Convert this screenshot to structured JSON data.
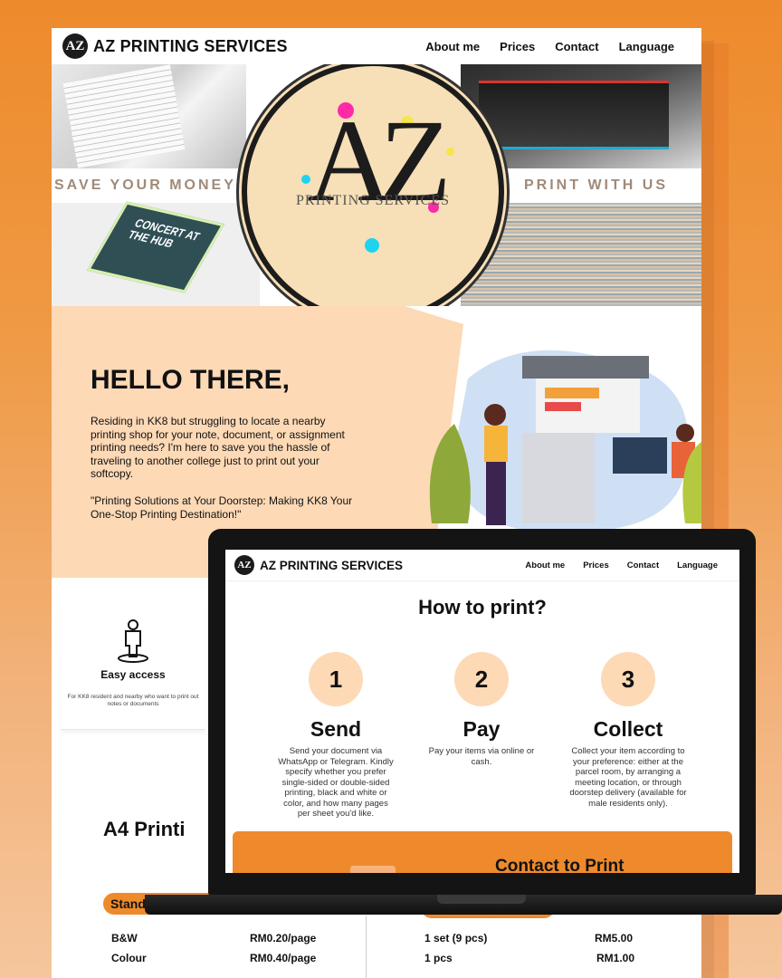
{
  "brand": {
    "logo": "AZ",
    "name": "AZ PRINTING SERVICES"
  },
  "nav": [
    "About me",
    "Prices",
    "Contact",
    "Language"
  ],
  "hero": {
    "left_text": "SAVE YOUR MONEY",
    "right_text": "PRINT WITH US",
    "circle_logo": "AZ",
    "circle_sub": "PRINTING SERVICES",
    "flyer_text": "CONCERT AT THE HUB"
  },
  "hello": {
    "title": "HELLO THERE,",
    "p1": "Residing in KK8 but struggling to locate a nearby printing shop for your note, document, or assignment printing needs? I'm here to save you the hassle of traveling to another college just to print out your softcopy.",
    "p2": "\"Printing Solutions at Your Doorstep: Making KK8 Your One-Stop Printing Destination!\""
  },
  "feature": {
    "title": "Easy access",
    "desc": "For KK8 resident and nearby who want to print out notes or documents"
  },
  "pricing": {
    "title": "A4 Printi",
    "pill_left": "Stand",
    "rows_left": [
      {
        "label": "B&W",
        "price": "RM0.20/page"
      },
      {
        "label": "Colour",
        "price": "RM0.40/page"
      }
    ],
    "rows_right": [
      {
        "label": "1 set (9 pcs)",
        "price": "RM5.00"
      },
      {
        "label": "1 pcs",
        "price": "RM1.00"
      }
    ]
  },
  "laptop": {
    "brand": "AZ PRINTING SERVICES",
    "logo": "AZ",
    "nav": [
      "About me",
      "Prices",
      "Contact",
      "Language"
    ],
    "heading": "How to print?",
    "steps": [
      {
        "num": "1",
        "title": "Send",
        "desc": "Send your document via WhatsApp or Telegram. Kindly specify whether you prefer single-sided or double-sided printing, black and white or color, and how many pages per sheet you'd like."
      },
      {
        "num": "2",
        "title": "Pay",
        "desc": "Pay your items via online or cash."
      },
      {
        "num": "3",
        "title": "Collect",
        "desc": "Collect your item according to your preference: either at the parcel room, by arranging a meeting location, or through doorstep delivery (available for male residents only)."
      }
    ],
    "cta": "Contact to Print"
  },
  "colors": {
    "accent": "#ee8a2c",
    "peach": "#fdd9b6",
    "dark": "#141414"
  }
}
